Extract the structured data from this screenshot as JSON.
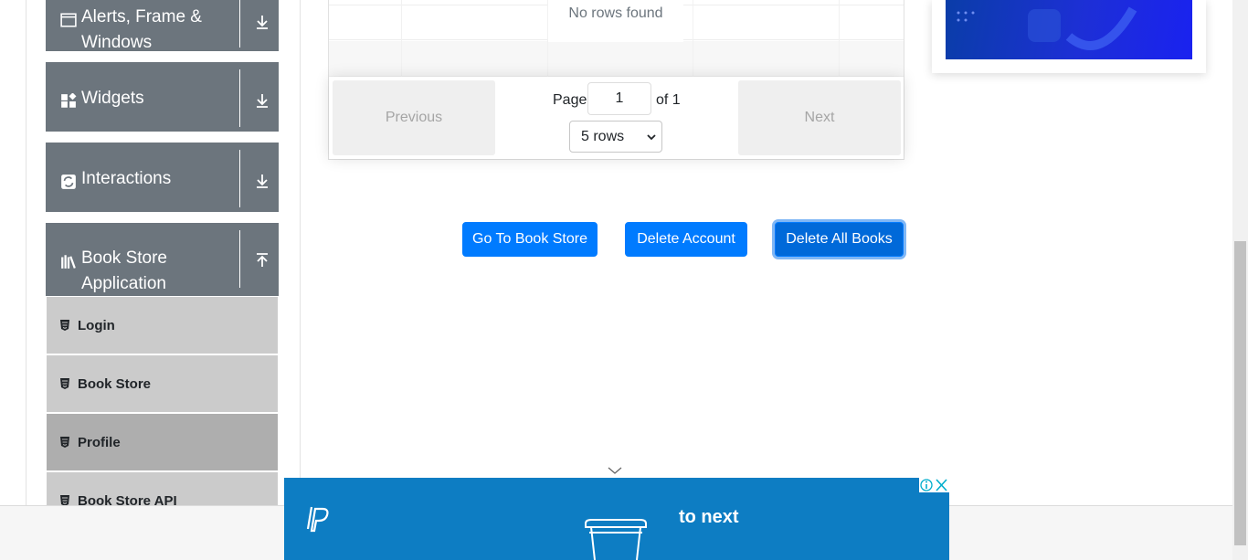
{
  "sidebar": {
    "groups": [
      {
        "label_line1": "Alerts, Frame &",
        "label_line2": "Windows",
        "icon": "window-icon",
        "toggle": "arrow-down-icon"
      },
      {
        "label": "Widgets",
        "icon": "widgets-icon",
        "toggle": "arrow-down-icon"
      },
      {
        "label": "Interactions",
        "icon": "interactions-icon",
        "toggle": "arrow-down-icon"
      },
      {
        "label_line1": "Book Store",
        "label_line2": "Application",
        "icon": "library-icon",
        "toggle": "arrow-up-icon"
      }
    ],
    "items": [
      {
        "label": "Login",
        "icon": "html5-icon"
      },
      {
        "label": "Book Store",
        "icon": "html5-icon"
      },
      {
        "label": "Profile",
        "icon": "html5-icon",
        "active": true
      },
      {
        "label": "Book Store API",
        "icon": "html5-icon"
      }
    ]
  },
  "table": {
    "empty_text": "No rows found",
    "pagination": {
      "previous_label": "Previous",
      "next_label": "Next",
      "page_label": "Page",
      "page_value": "1",
      "of_label": "of 1",
      "rows_selected": "5 rows"
    }
  },
  "actions": {
    "go_to_book_store": "Go To Book Store",
    "delete_account": "Delete Account",
    "delete_all_books": "Delete All Books"
  },
  "ad_banner": {
    "text": "to next",
    "logo": "paypal-icon"
  },
  "colors": {
    "sidebar_group": "#6c757d",
    "sidebar_item": "#cbcbcb",
    "sidebar_item_active": "#aeaeae",
    "primary_button": "#007bff",
    "banner": "#0d7dc3"
  }
}
